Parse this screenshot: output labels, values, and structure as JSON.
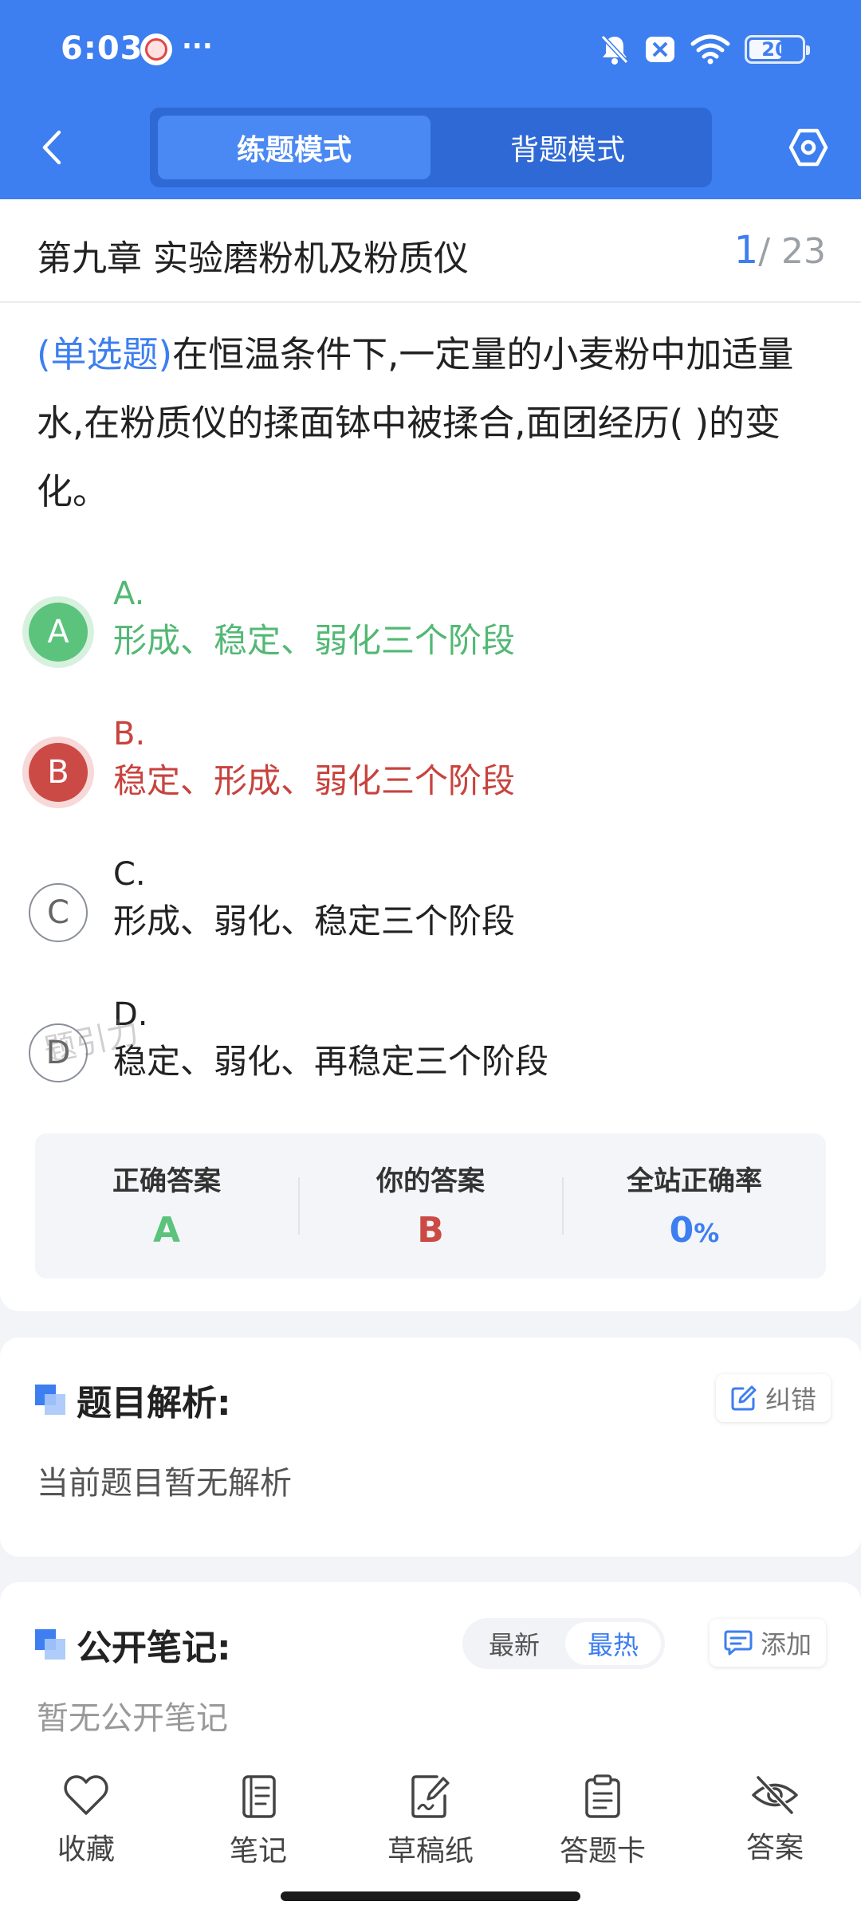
{
  "status_bar": {
    "time": "6:03",
    "dots": "···",
    "battery": "20"
  },
  "header": {
    "tabs": [
      {
        "label": "练题模式",
        "active": true
      },
      {
        "label": "背题模式",
        "active": false
      }
    ]
  },
  "question": {
    "chapter": "第九章 实验磨粉机及粉质仪",
    "index_current": "1",
    "index_total": "/ 23",
    "type": "(单选题)",
    "text": "在恒温条件下,一定量的小麦粉中加适量水,在粉质仪的揉面钵中被揉合,面团经历(     )的变化。",
    "options": [
      {
        "circle": "A",
        "letter": "A.",
        "text": "形成、稳定、弱化三个阶段",
        "state": "correct"
      },
      {
        "circle": "B",
        "letter": "B.",
        "text": "稳定、形成、弱化三个阶段",
        "state": "wrong"
      },
      {
        "circle": "C",
        "letter": "C.",
        "text": "形成、弱化、稳定三个阶段",
        "state": "none"
      },
      {
        "circle": "D",
        "letter": "D.",
        "text": "稳定、弱化、再稳定三个阶段",
        "state": "none"
      }
    ],
    "watermark": "题引力",
    "answers": {
      "correct_label": "正确答案",
      "correct_value": "A",
      "yours_label": "你的答案",
      "yours_value": "B",
      "rate_label": "全站正确率",
      "rate_value": "0",
      "rate_unit": "%"
    }
  },
  "analysis": {
    "title": "题目解析:",
    "report_label": "纠错",
    "body": "当前题目暂无解析"
  },
  "notes": {
    "title": "公开笔记:",
    "sort_newest": "最新",
    "sort_hottest": "最热",
    "add_label": "添加",
    "body": "暂无公开笔记"
  },
  "bottom_nav": [
    {
      "label": "收藏",
      "icon": "heart-icon"
    },
    {
      "label": "笔记",
      "icon": "notebook-icon"
    },
    {
      "label": "草稿纸",
      "icon": "draft-icon"
    },
    {
      "label": "答题卡",
      "icon": "clipboard-icon"
    },
    {
      "label": "答案",
      "icon": "eye-off-icon"
    }
  ],
  "colors": {
    "brand": "#3d7ef0",
    "correct": "#5bc37c",
    "wrong": "#cc4a45"
  }
}
